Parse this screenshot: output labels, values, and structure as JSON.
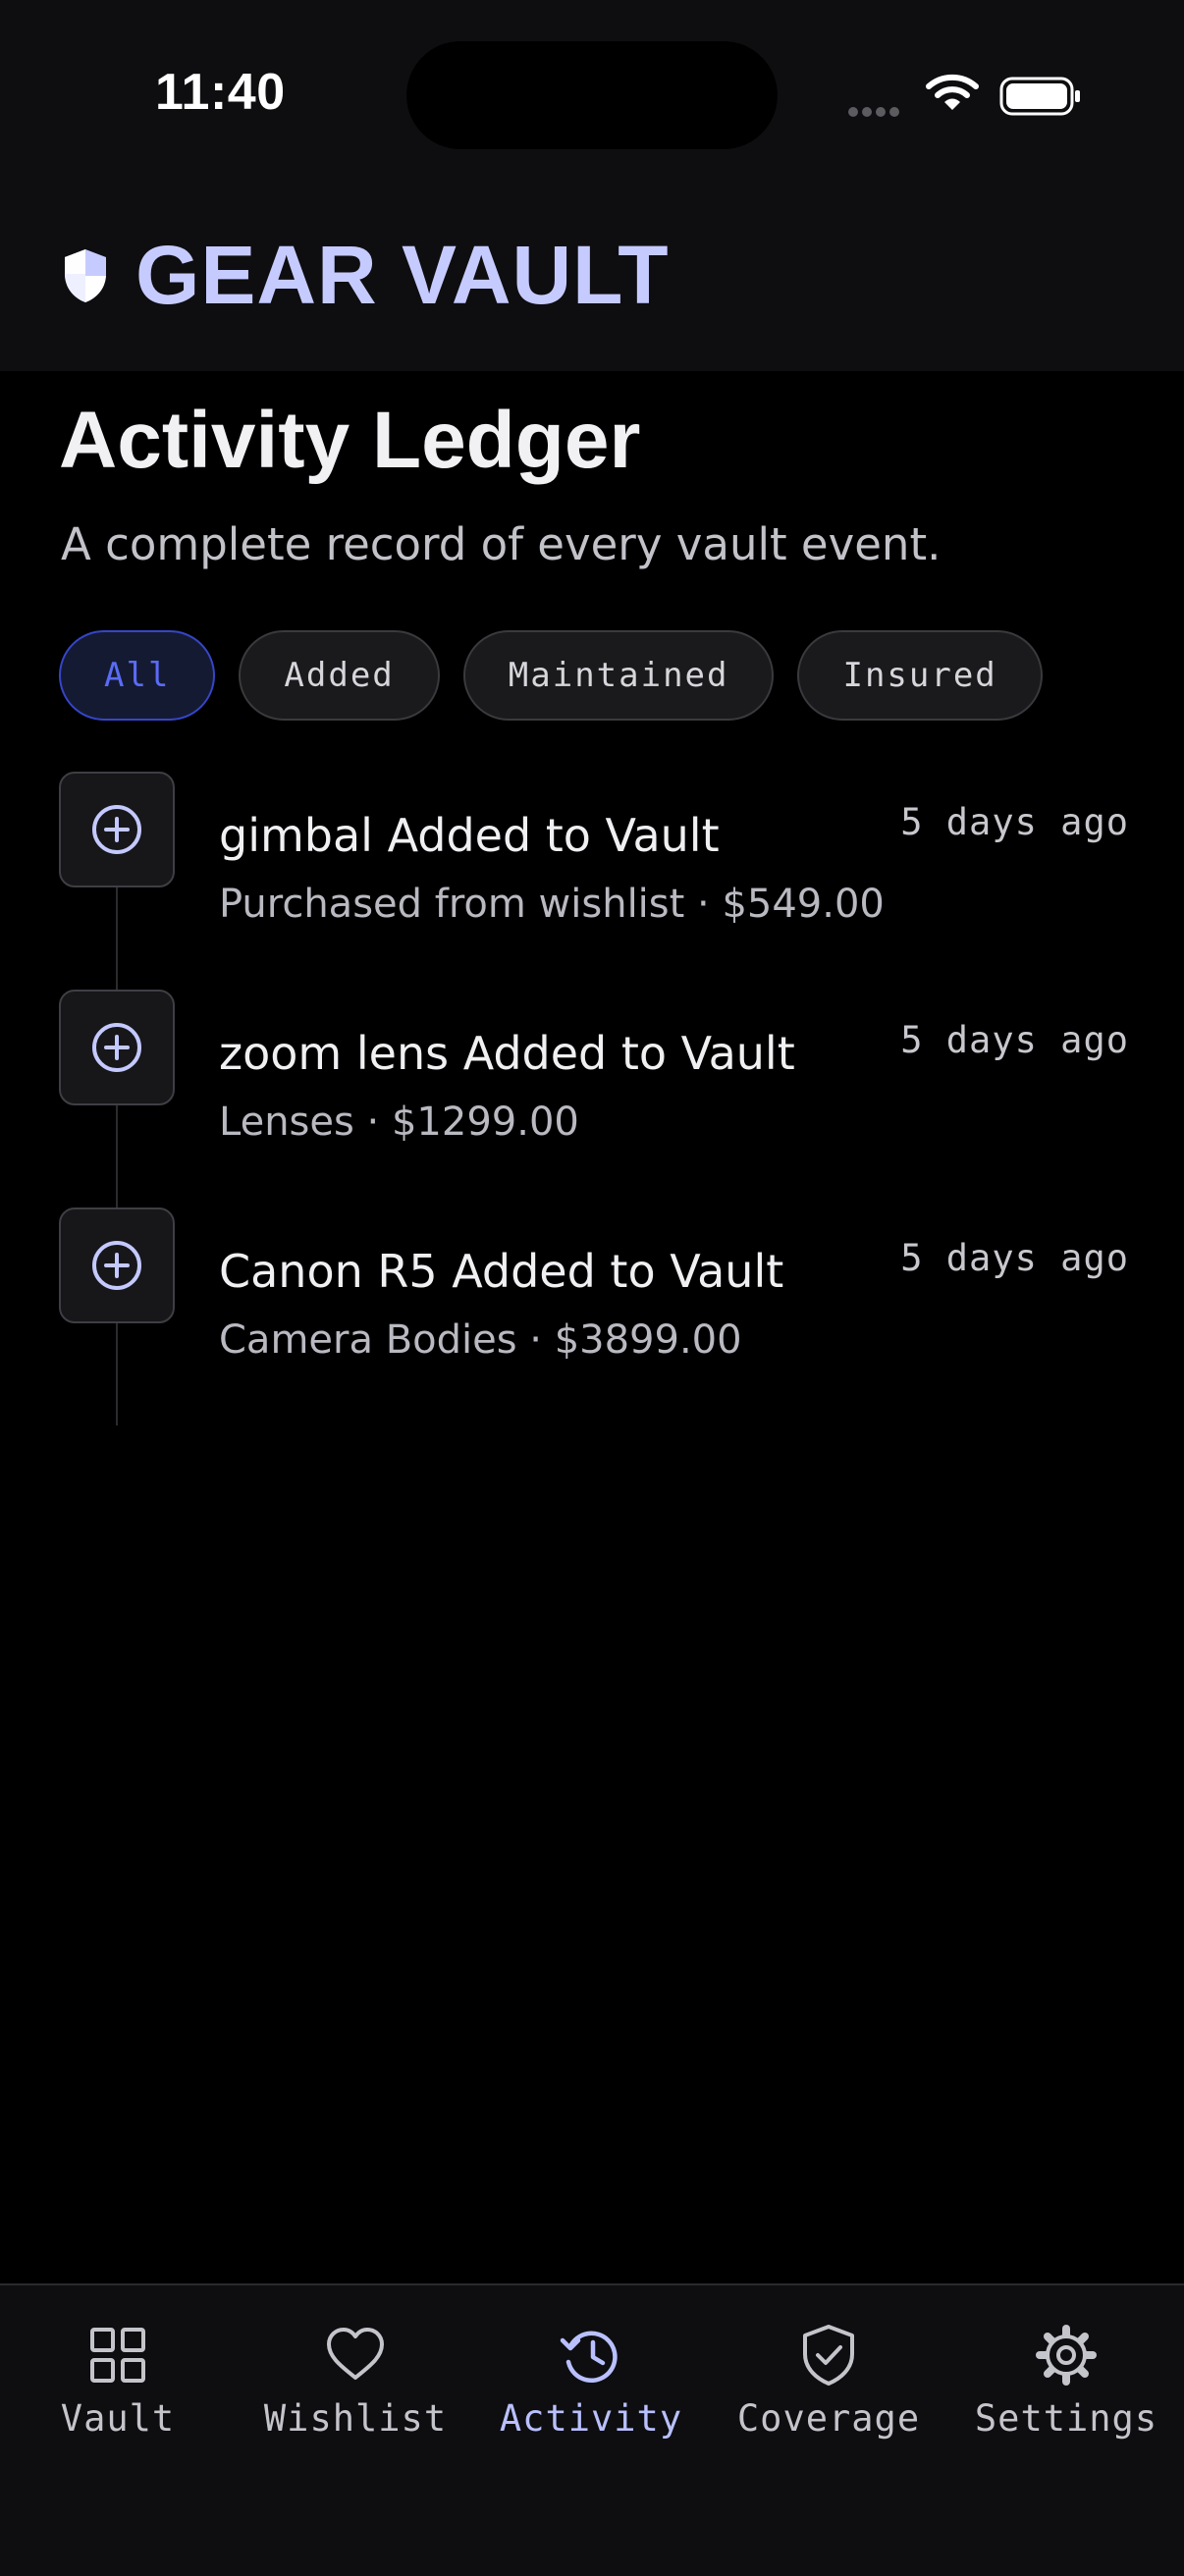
{
  "status_bar": {
    "time": "11:40"
  },
  "header": {
    "brand_title": "GEAR VAULT",
    "brand_icon": "shield-icon"
  },
  "page": {
    "title": "Activity Ledger",
    "subtitle": "A complete record of every vault event."
  },
  "filters": [
    {
      "label": "All",
      "active": true
    },
    {
      "label": "Added",
      "active": false
    },
    {
      "label": "Maintained",
      "active": false
    },
    {
      "label": "Insured",
      "active": false
    }
  ],
  "entries": [
    {
      "icon": "plus-circle-icon",
      "title": "gimbal Added to Vault",
      "meta": "Purchased from wishlist · $549.00",
      "time_ago": "5 days ago"
    },
    {
      "icon": "plus-circle-icon",
      "title": "zoom lens Added to Vault",
      "meta": "Lenses · $1299.00",
      "time_ago": "5 days ago"
    },
    {
      "icon": "plus-circle-icon",
      "title": "Canon R5 Added to Vault",
      "meta": "Camera Bodies · $3899.00",
      "time_ago": "5 days ago"
    }
  ],
  "tabs": [
    {
      "label": "Vault",
      "icon": "grid-icon",
      "active": false
    },
    {
      "label": "Wishlist",
      "icon": "heart-icon",
      "active": false
    },
    {
      "label": "Activity",
      "icon": "history-icon",
      "active": true
    },
    {
      "label": "Coverage",
      "icon": "shield-check-icon",
      "active": false
    },
    {
      "label": "Settings",
      "icon": "gear-icon",
      "active": false
    }
  ],
  "colors": {
    "background": "#000000",
    "header_bg": "#0e0e10",
    "brand": "#c6cbff",
    "accent": "#5a6cf5",
    "icon": "#c4c9ff"
  }
}
